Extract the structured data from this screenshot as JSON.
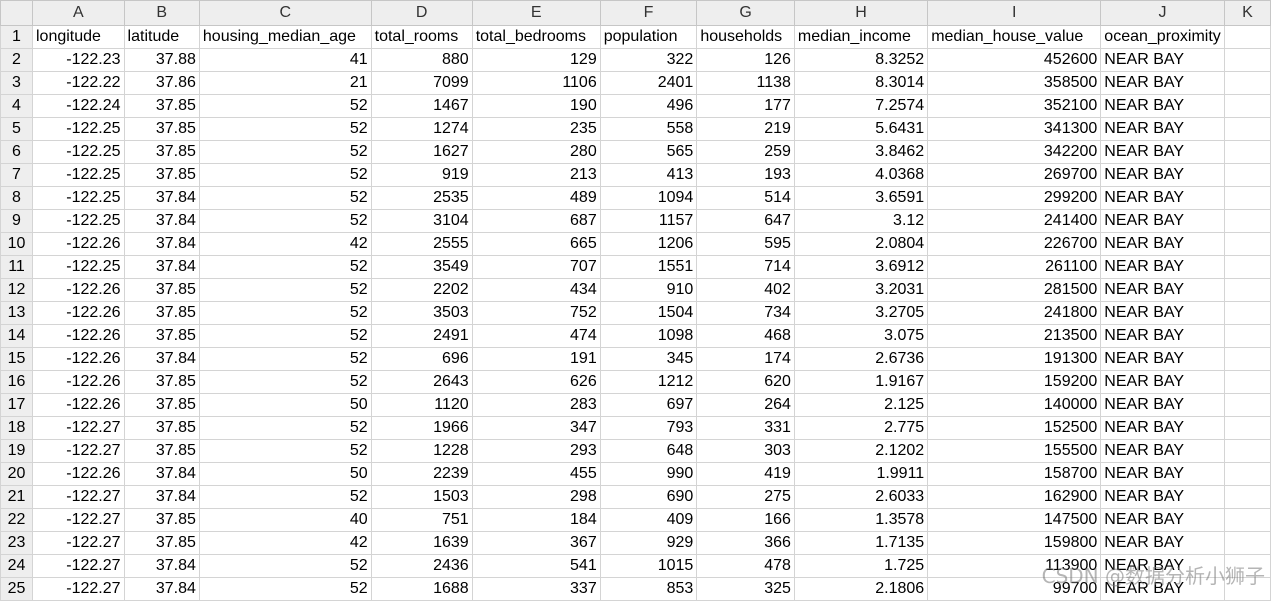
{
  "sheet": {
    "column_letters": [
      "A",
      "B",
      "C",
      "D",
      "E",
      "F",
      "G",
      "H",
      "I",
      "J",
      "K"
    ],
    "header_row": {
      "row_number": "1",
      "cells": [
        "longitude",
        "latitude",
        "housing_median_age",
        "total_rooms",
        "total_bedrooms",
        "population",
        "households",
        "median_income",
        "median_house_value",
        "ocean_proximity",
        ""
      ]
    },
    "rows": [
      {
        "row_number": "2",
        "cells": [
          "-122.23",
          "37.88",
          "41",
          "880",
          "129",
          "322",
          "126",
          "8.3252",
          "452600",
          "NEAR BAY",
          ""
        ]
      },
      {
        "row_number": "3",
        "cells": [
          "-122.22",
          "37.86",
          "21",
          "7099",
          "1106",
          "2401",
          "1138",
          "8.3014",
          "358500",
          "NEAR BAY",
          ""
        ]
      },
      {
        "row_number": "4",
        "cells": [
          "-122.24",
          "37.85",
          "52",
          "1467",
          "190",
          "496",
          "177",
          "7.2574",
          "352100",
          "NEAR BAY",
          ""
        ]
      },
      {
        "row_number": "5",
        "cells": [
          "-122.25",
          "37.85",
          "52",
          "1274",
          "235",
          "558",
          "219",
          "5.6431",
          "341300",
          "NEAR BAY",
          ""
        ]
      },
      {
        "row_number": "6",
        "cells": [
          "-122.25",
          "37.85",
          "52",
          "1627",
          "280",
          "565",
          "259",
          "3.8462",
          "342200",
          "NEAR BAY",
          ""
        ]
      },
      {
        "row_number": "7",
        "cells": [
          "-122.25",
          "37.85",
          "52",
          "919",
          "213",
          "413",
          "193",
          "4.0368",
          "269700",
          "NEAR BAY",
          ""
        ]
      },
      {
        "row_number": "8",
        "cells": [
          "-122.25",
          "37.84",
          "52",
          "2535",
          "489",
          "1094",
          "514",
          "3.6591",
          "299200",
          "NEAR BAY",
          ""
        ]
      },
      {
        "row_number": "9",
        "cells": [
          "-122.25",
          "37.84",
          "52",
          "3104",
          "687",
          "1157",
          "647",
          "3.12",
          "241400",
          "NEAR BAY",
          ""
        ]
      },
      {
        "row_number": "10",
        "cells": [
          "-122.26",
          "37.84",
          "42",
          "2555",
          "665",
          "1206",
          "595",
          "2.0804",
          "226700",
          "NEAR BAY",
          ""
        ]
      },
      {
        "row_number": "11",
        "cells": [
          "-122.25",
          "37.84",
          "52",
          "3549",
          "707",
          "1551",
          "714",
          "3.6912",
          "261100",
          "NEAR BAY",
          ""
        ]
      },
      {
        "row_number": "12",
        "cells": [
          "-122.26",
          "37.85",
          "52",
          "2202",
          "434",
          "910",
          "402",
          "3.2031",
          "281500",
          "NEAR BAY",
          ""
        ]
      },
      {
        "row_number": "13",
        "cells": [
          "-122.26",
          "37.85",
          "52",
          "3503",
          "752",
          "1504",
          "734",
          "3.2705",
          "241800",
          "NEAR BAY",
          ""
        ]
      },
      {
        "row_number": "14",
        "cells": [
          "-122.26",
          "37.85",
          "52",
          "2491",
          "474",
          "1098",
          "468",
          "3.075",
          "213500",
          "NEAR BAY",
          ""
        ]
      },
      {
        "row_number": "15",
        "cells": [
          "-122.26",
          "37.84",
          "52",
          "696",
          "191",
          "345",
          "174",
          "2.6736",
          "191300",
          "NEAR BAY",
          ""
        ]
      },
      {
        "row_number": "16",
        "cells": [
          "-122.26",
          "37.85",
          "52",
          "2643",
          "626",
          "1212",
          "620",
          "1.9167",
          "159200",
          "NEAR BAY",
          ""
        ]
      },
      {
        "row_number": "17",
        "cells": [
          "-122.26",
          "37.85",
          "50",
          "1120",
          "283",
          "697",
          "264",
          "2.125",
          "140000",
          "NEAR BAY",
          ""
        ]
      },
      {
        "row_number": "18",
        "cells": [
          "-122.27",
          "37.85",
          "52",
          "1966",
          "347",
          "793",
          "331",
          "2.775",
          "152500",
          "NEAR BAY",
          ""
        ]
      },
      {
        "row_number": "19",
        "cells": [
          "-122.27",
          "37.85",
          "52",
          "1228",
          "293",
          "648",
          "303",
          "2.1202",
          "155500",
          "NEAR BAY",
          ""
        ]
      },
      {
        "row_number": "20",
        "cells": [
          "-122.26",
          "37.84",
          "50",
          "2239",
          "455",
          "990",
          "419",
          "1.9911",
          "158700",
          "NEAR BAY",
          ""
        ]
      },
      {
        "row_number": "21",
        "cells": [
          "-122.27",
          "37.84",
          "52",
          "1503",
          "298",
          "690",
          "275",
          "2.6033",
          "162900",
          "NEAR BAY",
          ""
        ]
      },
      {
        "row_number": "22",
        "cells": [
          "-122.27",
          "37.85",
          "40",
          "751",
          "184",
          "409",
          "166",
          "1.3578",
          "147500",
          "NEAR BAY",
          ""
        ]
      },
      {
        "row_number": "23",
        "cells": [
          "-122.27",
          "37.85",
          "42",
          "1639",
          "367",
          "929",
          "366",
          "1.7135",
          "159800",
          "NEAR BAY",
          ""
        ]
      },
      {
        "row_number": "24",
        "cells": [
          "-122.27",
          "37.84",
          "52",
          "2436",
          "541",
          "1015",
          "478",
          "1.725",
          "113900",
          "NEAR BAY",
          ""
        ]
      },
      {
        "row_number": "25",
        "cells": [
          "-122.27",
          "37.84",
          "52",
          "1688",
          "337",
          "853",
          "325",
          "2.1806",
          "99700",
          "NEAR BAY",
          ""
        ]
      }
    ]
  },
  "watermark": "CSDN @数据分析小狮子"
}
